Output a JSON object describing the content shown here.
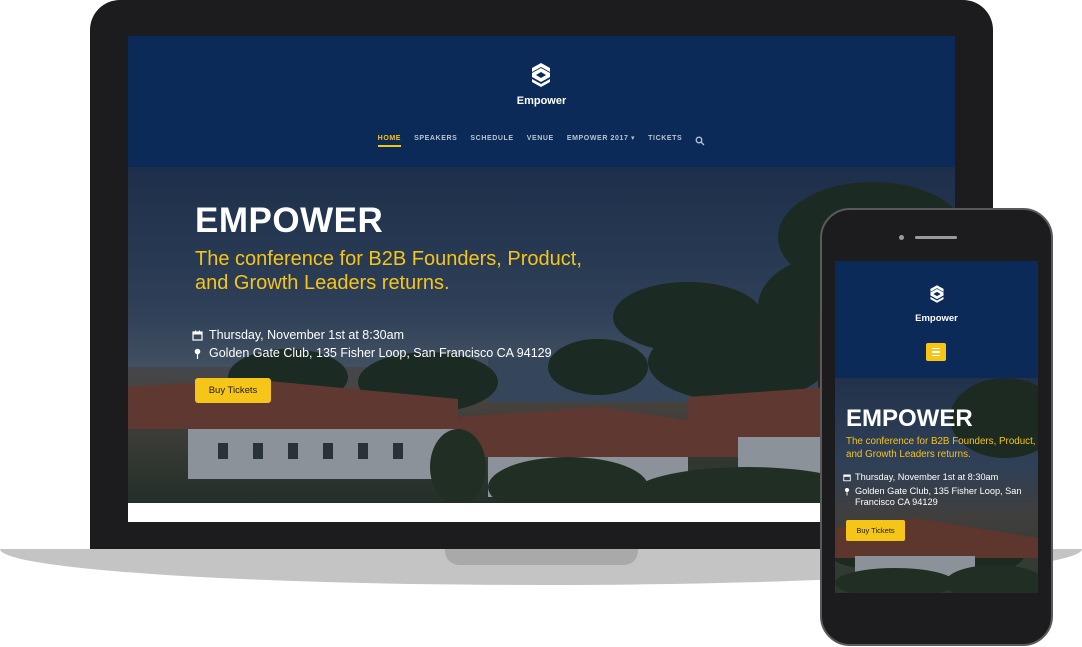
{
  "site": {
    "brand": "Empower",
    "nav": [
      {
        "label": "HOME",
        "active": true
      },
      {
        "label": "SPEAKERS",
        "active": false
      },
      {
        "label": "SCHEDULE",
        "active": false
      },
      {
        "label": "VENUE",
        "active": false
      },
      {
        "label": "EMPOWER 2017 ▾",
        "active": false
      },
      {
        "label": "TICKETS",
        "active": false
      }
    ],
    "nav_search_icon": "search-icon"
  },
  "hero": {
    "title": "EMPOWER",
    "subtitle": "The conference for B2B Founders, Product, and Growth Leaders returns.",
    "date": "Thursday, November 1st at 8:30am",
    "venue": "Golden Gate Club, 135 Fisher Loop, San Francisco CA 94129",
    "cta": "Buy Tickets"
  },
  "icons": {
    "logo": "empower-logo-icon",
    "date": "calendar-icon",
    "venue": "map-pin-icon",
    "mobile_menu": "hamburger-menu-icon"
  },
  "colors": {
    "header_navy": "#0b2a57",
    "accent_yellow": "#f5c518",
    "text_white": "#ffffff"
  }
}
